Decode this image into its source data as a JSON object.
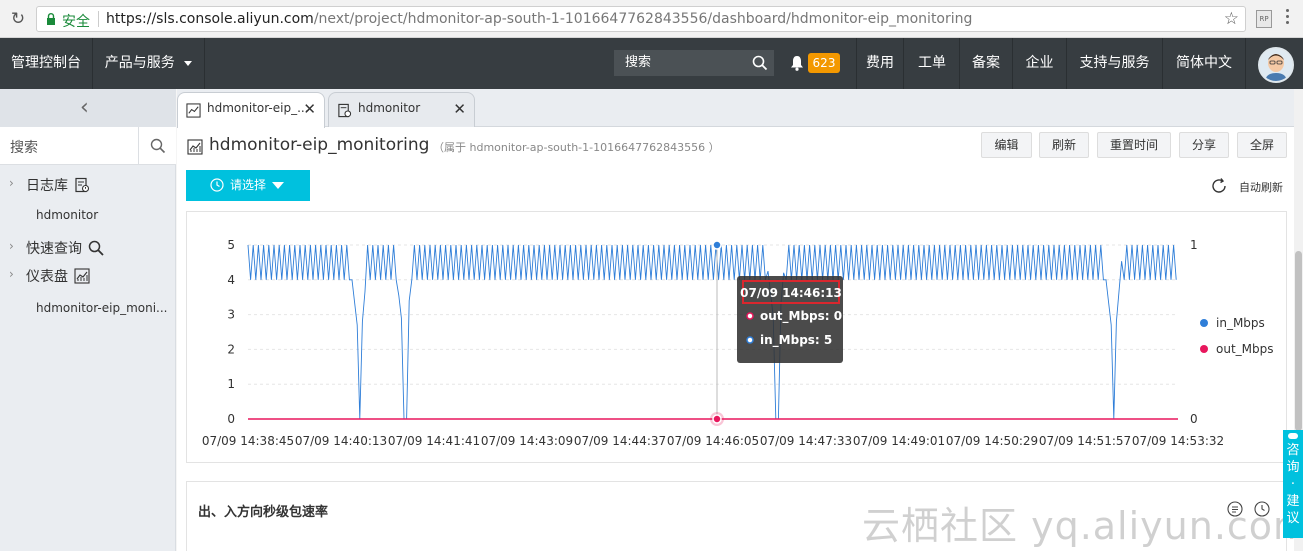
{
  "browser": {
    "secure_label": "安全",
    "url_host": "https://sls.console.aliyun.com",
    "url_path": "/next/project/hdmonitor-ap-south-1-1016647762843556/dashboard/hdmonitor-eip_monitoring",
    "ext_label": "RP"
  },
  "topnav": {
    "console": "管理控制台",
    "products": "产品与服务",
    "search_placeholder": "搜索",
    "notifications": "623",
    "items": [
      "费用",
      "工单",
      "备案",
      "企业",
      "支持与服务",
      "简体中文"
    ]
  },
  "sidebar": {
    "search_placeholder": "搜索",
    "items": [
      {
        "label": "日志库",
        "sub": "hdmonitor"
      },
      {
        "label": "快速查询",
        "sub": ""
      },
      {
        "label": "仪表盘",
        "sub": "hdmonitor-eip_moni..."
      }
    ]
  },
  "tabs": [
    {
      "label": "hdmonitor-eip_..."
    },
    {
      "label": "hdmonitor"
    }
  ],
  "dashboard": {
    "title": "hdmonitor-eip_monitoring",
    "subtitle": "（属于 hdmonitor-ap-south-1-1016647762843556 ）",
    "buttons": [
      "编辑",
      "刷新",
      "重置时间",
      "分享",
      "全屏"
    ],
    "time_select": "请选择",
    "auto_refresh": "自动刷新",
    "panel2_title": "出、入方向秒级包速率"
  },
  "chart_data": {
    "type": "line",
    "x_ticks": [
      "07/09 14:38:45",
      "07/09 14:40:13",
      "07/09 14:41:41",
      "07/09 14:43:09",
      "07/09 14:44:37",
      "07/09 14:46:05",
      "07/09 14:47:33",
      "07/09 14:49:01",
      "07/09 14:50:29",
      "07/09 14:51:57",
      "07/09 14:53:32"
    ],
    "y_left_ticks": [
      "0",
      "1",
      "2",
      "3",
      "4",
      "5"
    ],
    "y_right_ticks": [
      "0",
      "1"
    ],
    "ylim_left": [
      0,
      5
    ],
    "ylim_right": [
      0,
      1
    ],
    "grid": true,
    "legend_position": "right",
    "series": [
      {
        "name": "in_Mbps",
        "color": "#2f7ed8",
        "axis": "left",
        "baseline_pattern": "oscillates between 4 and 5",
        "dips_to_zero_near": [
          "07/09 14:40:13",
          "07/09 14:41:20",
          "07/09 14:47:10",
          "07/09 14:51:57"
        ]
      },
      {
        "name": "out_Mbps",
        "color": "#e8175d",
        "axis": "right",
        "constant_value": 0
      }
    ],
    "tooltip": {
      "time": "07/09 14:46:13",
      "rows": [
        {
          "label": "out_Mbps: 0",
          "color": "#e8175d"
        },
        {
          "label": "in_Mbps: 5",
          "color": "#2f7ed8"
        }
      ]
    }
  },
  "watermark": "云栖社区 yq.aliyun.com",
  "consult": "咨询·建议"
}
